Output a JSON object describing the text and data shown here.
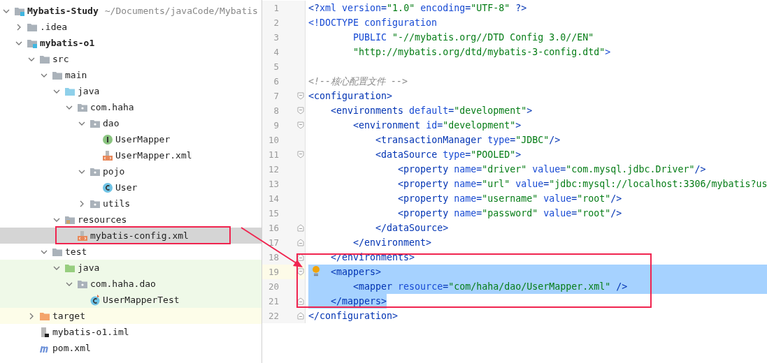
{
  "project_tree": {
    "rows": [
      {
        "label": "Mybatis-Study",
        "path": "~/Documents/javaCode/Mybatis",
        "kind": "module",
        "expanded": true,
        "bold": true,
        "selected": false,
        "children": [
          {
            "label": ".idea",
            "kind": "folder",
            "expanded": false,
            "selected": false
          },
          {
            "label": "mybatis-o1",
            "kind": "module",
            "expanded": true,
            "bold": true,
            "selected": false,
            "children": [
              {
                "label": "src",
                "kind": "folder",
                "expanded": true,
                "selected": false,
                "children": [
                  {
                    "label": "main",
                    "kind": "folder",
                    "expanded": true,
                    "selected": false,
                    "children": [
                      {
                        "label": "java",
                        "kind": "source",
                        "expanded": true,
                        "selected": false,
                        "children": [
                          {
                            "label": "com.haha",
                            "kind": "package",
                            "expanded": true,
                            "selected": false,
                            "children": [
                              {
                                "label": "dao",
                                "kind": "package",
                                "expanded": true,
                                "selected": false,
                                "children": [
                                  {
                                    "label": "UserMapper",
                                    "kind": "interface",
                                    "selected": false
                                  },
                                  {
                                    "label": "UserMapper.xml",
                                    "kind": "xml",
                                    "selected": false
                                  }
                                ]
                              },
                              {
                                "label": "pojo",
                                "kind": "package",
                                "expanded": true,
                                "selected": false,
                                "children": [
                                  {
                                    "label": "User",
                                    "kind": "class",
                                    "selected": false
                                  }
                                ]
                              },
                              {
                                "label": "utils",
                                "kind": "package",
                                "expanded": false,
                                "selected": false
                              }
                            ]
                          }
                        ]
                      },
                      {
                        "label": "resources",
                        "kind": "resources",
                        "expanded": true,
                        "selected": false,
                        "children": [
                          {
                            "label": "mybatis-config.xml",
                            "kind": "xml",
                            "selected": true
                          }
                        ]
                      }
                    ]
                  },
                  {
                    "label": "test",
                    "kind": "folder",
                    "expanded": true,
                    "selected": false,
                    "children": [
                      {
                        "label": "java",
                        "kind": "test",
                        "expanded": true,
                        "in_test": true,
                        "selected": false,
                        "children": [
                          {
                            "label": "com.haha.dao",
                            "kind": "package",
                            "expanded": true,
                            "in_test": true,
                            "selected": false,
                            "children": [
                              {
                                "label": "UserMapperTest",
                                "kind": "testclass",
                                "in_test": true,
                                "selected": false
                              }
                            ]
                          }
                        ]
                      }
                    ]
                  }
                ]
              },
              {
                "label": "target",
                "kind": "excluded",
                "expanded": false,
                "excluded": true,
                "selected": false
              },
              {
                "label": "mybatis-o1.iml",
                "kind": "iml",
                "selected": false
              },
              {
                "label": "pom.xml",
                "kind": "maven",
                "selected": false
              }
            ]
          }
        ]
      }
    ]
  },
  "editor": {
    "lines": [
      {
        "number": "1",
        "tokens": [
          {
            "kind": "tag",
            "text": "<?"
          },
          {
            "kind": "attr",
            "text": "xml "
          },
          {
            "kind": "attr",
            "text": "version"
          },
          {
            "kind": "tag",
            "text": "="
          },
          {
            "kind": "value",
            "text": "\"1.0\" "
          },
          {
            "kind": "attr",
            "text": "encoding"
          },
          {
            "kind": "tag",
            "text": "="
          },
          {
            "kind": "value",
            "text": "\"UTF-8\" "
          },
          {
            "kind": "tag",
            "text": "?>"
          }
        ]
      },
      {
        "number": "2",
        "tokens": [
          {
            "kind": "attr",
            "text": "<!DOCTYPE configuration"
          }
        ]
      },
      {
        "number": "3",
        "tokens": [
          {
            "kind": "attr",
            "text": "        PUBLIC "
          },
          {
            "kind": "value",
            "text": "\"-//mybatis.org//DTD Config 3.0//EN\""
          }
        ]
      },
      {
        "number": "4",
        "tokens": [
          {
            "kind": "value",
            "text": "        \"http://mybatis.org/dtd/mybatis-3-config.dtd\""
          },
          {
            "kind": "attr",
            "text": ">"
          }
        ]
      },
      {
        "number": "5"
      },
      {
        "number": "6",
        "tokens": [
          {
            "kind": "comment",
            "text": "<!--核心配置文件 -->"
          }
        ]
      },
      {
        "number": "7",
        "fold_start": true,
        "tokens": [
          {
            "kind": "tag",
            "text": "<configuration>"
          }
        ]
      },
      {
        "number": "8",
        "fold_start": true,
        "tokens": [
          {
            "kind": "tag",
            "text": "    <environments "
          },
          {
            "kind": "attr",
            "text": "default"
          },
          {
            "kind": "tag",
            "text": "="
          },
          {
            "kind": "value",
            "text": "\"development\""
          },
          {
            "kind": "tag",
            "text": ">"
          }
        ]
      },
      {
        "number": "9",
        "fold_start": true,
        "tokens": [
          {
            "kind": "tag",
            "text": "        <environment "
          },
          {
            "kind": "attr",
            "text": "id"
          },
          {
            "kind": "tag",
            "text": "="
          },
          {
            "kind": "value",
            "text": "\"development\""
          },
          {
            "kind": "tag",
            "text": ">"
          }
        ]
      },
      {
        "number": "10",
        "tokens": [
          {
            "kind": "tag",
            "text": "            <transactionManager "
          },
          {
            "kind": "attr",
            "text": "type"
          },
          {
            "kind": "tag",
            "text": "="
          },
          {
            "kind": "value",
            "text": "\"JDBC\""
          },
          {
            "kind": "tag",
            "text": "/>"
          }
        ]
      },
      {
        "number": "11",
        "fold_start": true,
        "tokens": [
          {
            "kind": "tag",
            "text": "            <dataSource "
          },
          {
            "kind": "attr",
            "text": "type"
          },
          {
            "kind": "tag",
            "text": "="
          },
          {
            "kind": "value",
            "text": "\"POOLED\""
          },
          {
            "kind": "tag",
            "text": ">"
          }
        ]
      },
      {
        "number": "12",
        "tokens": [
          {
            "kind": "tag",
            "text": "                <property "
          },
          {
            "kind": "attr",
            "text": "name"
          },
          {
            "kind": "tag",
            "text": "="
          },
          {
            "kind": "value",
            "text": "\"driver\" "
          },
          {
            "kind": "attr",
            "text": "value"
          },
          {
            "kind": "tag",
            "text": "="
          },
          {
            "kind": "value",
            "text": "\"com.mysql.jdbc.Driver\""
          },
          {
            "kind": "tag",
            "text": "/>"
          }
        ]
      },
      {
        "number": "13",
        "tokens": [
          {
            "kind": "tag",
            "text": "                <property "
          },
          {
            "kind": "attr",
            "text": "name"
          },
          {
            "kind": "tag",
            "text": "="
          },
          {
            "kind": "value",
            "text": "\"url\" "
          },
          {
            "kind": "attr",
            "text": "value"
          },
          {
            "kind": "tag",
            "text": "="
          },
          {
            "kind": "value",
            "text": "\"jdbc:mysql://localhost:3306/mybatis?us"
          }
        ]
      },
      {
        "number": "14",
        "tokens": [
          {
            "kind": "tag",
            "text": "                <property "
          },
          {
            "kind": "attr",
            "text": "name"
          },
          {
            "kind": "tag",
            "text": "="
          },
          {
            "kind": "value",
            "text": "\"username\" "
          },
          {
            "kind": "attr",
            "text": "value"
          },
          {
            "kind": "tag",
            "text": "="
          },
          {
            "kind": "value",
            "text": "\"root\""
          },
          {
            "kind": "tag",
            "text": "/>"
          }
        ]
      },
      {
        "number": "15",
        "tokens": [
          {
            "kind": "tag",
            "text": "                <property "
          },
          {
            "kind": "attr",
            "text": "name"
          },
          {
            "kind": "tag",
            "text": "="
          },
          {
            "kind": "value",
            "text": "\"password\" "
          },
          {
            "kind": "attr",
            "text": "value"
          },
          {
            "kind": "tag",
            "text": "="
          },
          {
            "kind": "value",
            "text": "\"root\""
          },
          {
            "kind": "tag",
            "text": "/>"
          }
        ]
      },
      {
        "number": "16",
        "fold_end": true,
        "tokens": [
          {
            "kind": "tag",
            "text": "            </dataSource>"
          }
        ]
      },
      {
        "number": "17",
        "fold_end": true,
        "tokens": [
          {
            "kind": "tag",
            "text": "        </environment>"
          }
        ]
      },
      {
        "number": "18",
        "fold_end": true,
        "tokens": [
          {
            "kind": "tag",
            "text": "    </environments>"
          }
        ]
      },
      {
        "number": "19",
        "fold_start": true,
        "current": true,
        "bulb": true,
        "selected": true,
        "tokens": [
          {
            "kind": "tag",
            "text": "    <mappers>"
          }
        ]
      },
      {
        "number": "20",
        "selected": true,
        "tokens": [
          {
            "kind": "tag",
            "text": "        <mapper "
          },
          {
            "kind": "attr",
            "text": "resource"
          },
          {
            "kind": "tag",
            "text": "="
          },
          {
            "kind": "value",
            "text": "\"com/haha/dao/UserMapper.xml\" "
          },
          {
            "kind": "tag",
            "text": "/>"
          }
        ]
      },
      {
        "number": "21",
        "fold_end": true,
        "selected": true,
        "selection_ends_at_text": true,
        "tokens": [
          {
            "kind": "tag",
            "text": "    </mappers>"
          }
        ]
      },
      {
        "number": "22",
        "fold_end": true,
        "tokens": [
          {
            "kind": "tag",
            "text": "</configuration>"
          }
        ]
      }
    ]
  }
}
